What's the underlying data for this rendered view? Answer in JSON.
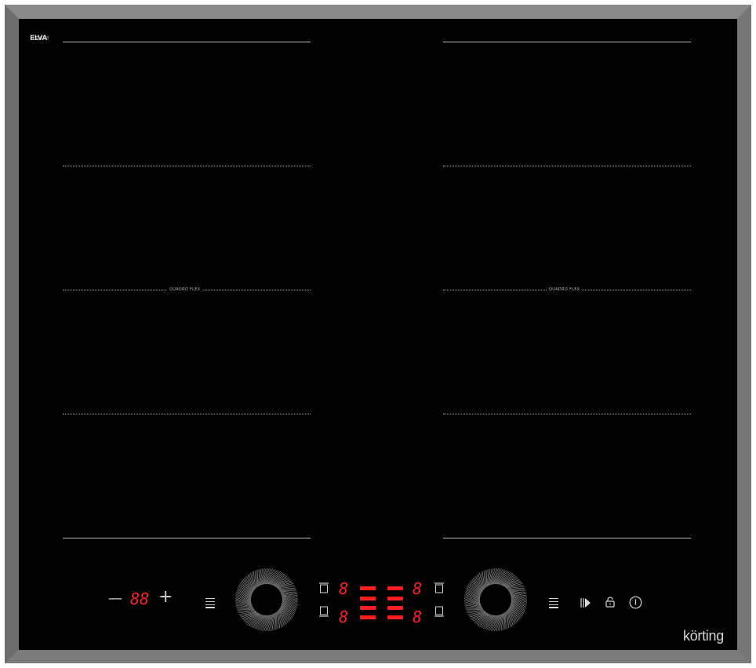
{
  "brand": {
    "maker_logo": "ELVA",
    "maker_sub": "ITALY",
    "name": "körting"
  },
  "zones": {
    "left": {
      "label": "QUADRO FLEX"
    },
    "right": {
      "label": "QUADRO FLEX"
    }
  },
  "controls": {
    "timer": {
      "minus": "—",
      "display": "88",
      "plus": "+"
    },
    "zone_displays": {
      "top_left": "8",
      "top_right": "8",
      "bottom_left": "8",
      "bottom_right": "8"
    },
    "icons": [
      "menu-icon",
      "slider-ring-icon",
      "zone-indicator-icon",
      "boost-icon",
      "lock-icon",
      "power-icon"
    ]
  },
  "colors": {
    "glass": "#000000",
    "frame": "#6e6e6e",
    "display_red": "#ff2020",
    "markings": "#bdbdbd"
  }
}
